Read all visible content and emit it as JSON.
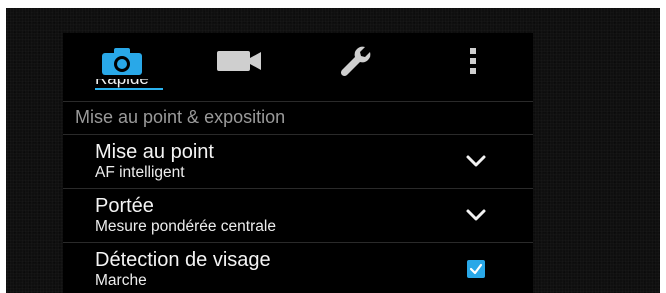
{
  "tabs": [
    {
      "icon": "camera-icon",
      "active": true,
      "color": "#29a8e8"
    },
    {
      "icon": "video-camera-icon",
      "active": false,
      "color": "#cfcfcf"
    },
    {
      "icon": "wrench-icon",
      "active": false,
      "color": "#cfcfcf"
    },
    {
      "icon": "more-vertical-icon",
      "active": false,
      "color": "#cfcfcf"
    }
  ],
  "cutoff_item": {
    "label": "Rapide"
  },
  "section": {
    "title": "Mise au point & exposition"
  },
  "settings": [
    {
      "title": "Mise au point",
      "value": "AF intelligent",
      "control": "dropdown"
    },
    {
      "title": "Portée",
      "value": "Mesure pondérée centrale",
      "control": "dropdown"
    },
    {
      "title": "Détection de visage",
      "value": "Marche",
      "control": "checkbox",
      "checked": true
    }
  ],
  "colors": {
    "accent": "#29a8e8",
    "background": "#000000",
    "section_text": "#9a9a9a",
    "primary_text": "#f4f4f4"
  }
}
